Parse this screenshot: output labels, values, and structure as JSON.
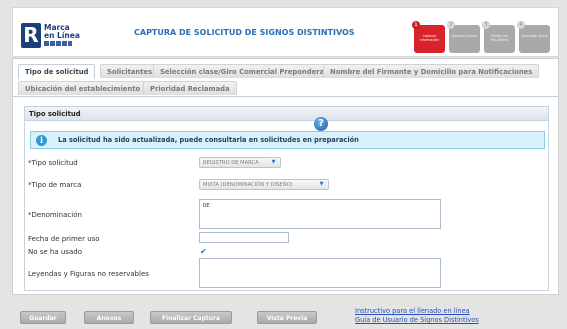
{
  "header": {
    "logo_letter": "R",
    "logo_text_line1": "Marca",
    "logo_text_line2": "en Línea",
    "title": "CAPTURA DE SOLICITUD DE SIGNOS DISTINTIVOS"
  },
  "steps": [
    {
      "number": "1",
      "label": "Capturar información",
      "active": true
    },
    {
      "number": "2",
      "label": "Adjuntar Anexos",
      "active": false
    },
    {
      "number": "3",
      "label": "Firmar con FIEL/Efirma",
      "active": false
    },
    {
      "number": "4",
      "label": "Descargar Acuse",
      "active": false
    }
  ],
  "tabs": [
    "Tipo de solicitud",
    "Solicitantes",
    "Selección clase/Giro Comercial Preponderante",
    "Nombre del Firmante y Domicilio para Notificaciones",
    "Ubicación del establecimiento",
    "Prioridad Reclamada"
  ],
  "panel": {
    "title": "Tipo solicitud",
    "notice": "La solicitud ha sido actualizada, puede consultarla en solicitudes en preparación"
  },
  "form": {
    "tipo_solicitud_label": "*Tipo solicitud",
    "tipo_solicitud_value": "REGISTRO DE MARCA",
    "tipo_marca_label": "*Tipo de marca",
    "tipo_marca_value": "MIXTA (DENOMINACIÓN Y DISEÑO)",
    "denominacion_label": "*Denominación",
    "denominacion_value": "DE",
    "fecha_label": "Fecha de primer uso",
    "fecha_value": "",
    "no_usado_label": "No se ha usado",
    "no_usado_checked": true,
    "leyendas_label": "Leyendas y Figuras no reservables",
    "leyendas_value": ""
  },
  "footer": {
    "guardar": "Guardar",
    "anexos": "Anexos",
    "finalizar": "Finalizar Captura",
    "vista": "Vista Previa",
    "link1": "Instructivo para el llenado en línea",
    "link2": "Guía de Usuario de Signos Distintivos"
  },
  "colors": {
    "accent_blue": "#2b6fb6",
    "active_step_red": "#d8232a",
    "notice_bg": "#d7f0fa"
  }
}
